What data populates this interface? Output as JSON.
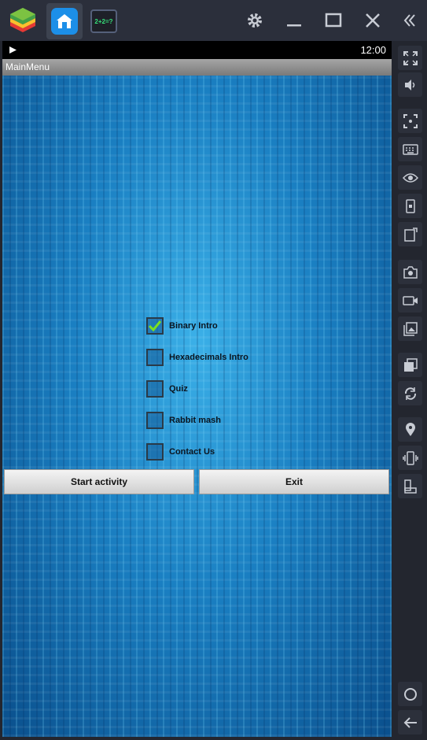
{
  "emulator": {
    "tabs": [
      {
        "name": "home"
      },
      {
        "name": "math-game"
      }
    ],
    "game_tab_label": "2+2=?"
  },
  "android": {
    "status_time": "12:00",
    "app_title": "MainMenu"
  },
  "menu": {
    "options": [
      {
        "label": "Binary Intro",
        "checked": true
      },
      {
        "label": "Hexadecimals Intro",
        "checked": false
      },
      {
        "label": "Quiz",
        "checked": false
      },
      {
        "label": "Rabbit mash",
        "checked": false
      },
      {
        "label": "Contact Us",
        "checked": false
      }
    ],
    "start_button": "Start activity",
    "exit_button": "Exit"
  },
  "colors": {
    "checkmark": "#7be01f",
    "accent_blue": "#1c8fe8"
  }
}
